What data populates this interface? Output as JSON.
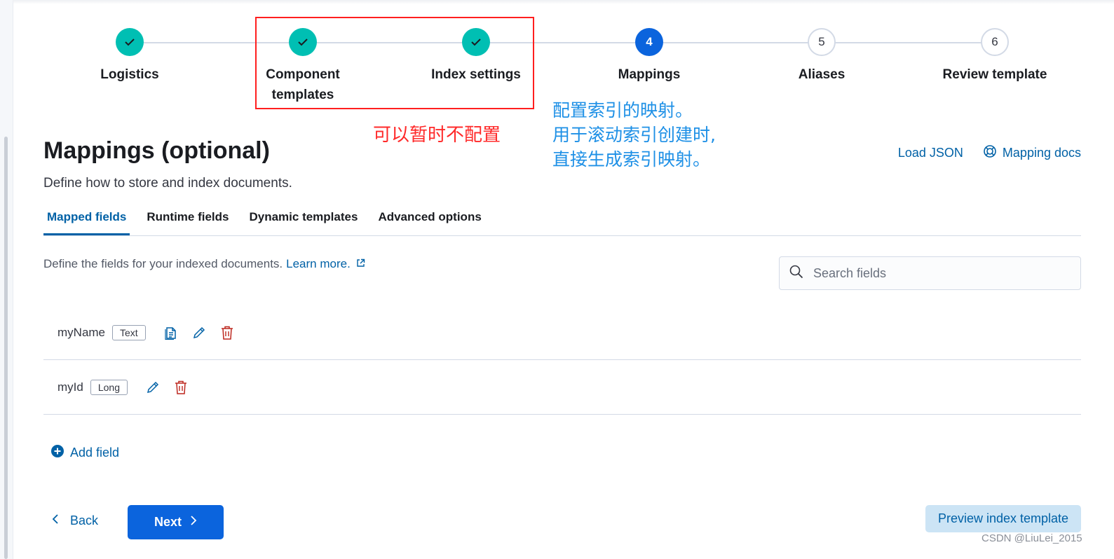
{
  "stepper": {
    "steps": [
      {
        "label": "Logistics",
        "state": "done"
      },
      {
        "label": "Component templates",
        "state": "done"
      },
      {
        "label": "Index settings",
        "state": "done"
      },
      {
        "label": "Mappings",
        "number": "4",
        "state": "current"
      },
      {
        "label": "Aliases",
        "number": "5",
        "state": "todo"
      },
      {
        "label": "Review template",
        "number": "6",
        "state": "todo"
      }
    ]
  },
  "annotations": {
    "red_note": "可以暂时不配置",
    "blue_lines": [
      "配置索引的映射。",
      "用于滚动索引创建时,",
      "直接生成索引映射。"
    ]
  },
  "header": {
    "title": "Mappings (optional)",
    "description": "Define how to store and index documents.",
    "load_json": "Load JSON",
    "mapping_docs": "Mapping docs"
  },
  "tabs": [
    "Mapped fields",
    "Runtime fields",
    "Dynamic templates",
    "Advanced options"
  ],
  "mapped_fields": {
    "description": "Define the fields for your indexed documents.",
    "learn_more": "Learn more.",
    "search_placeholder": "Search fields",
    "fields": [
      {
        "name": "myName",
        "type": "Text"
      },
      {
        "name": "myId",
        "type": "Long"
      }
    ],
    "add_field": "Add field"
  },
  "footer": {
    "back": "Back",
    "next": "Next",
    "preview": "Preview index template"
  },
  "watermark": "CSDN @LiuLei_2015",
  "colors": {
    "accent": "#0b64dd",
    "link": "#0061a6",
    "done": "#00bfb3",
    "danger": "#bd271e",
    "annotation_red": "#ff1f1f",
    "annotation_blue": "#1e90e6"
  }
}
